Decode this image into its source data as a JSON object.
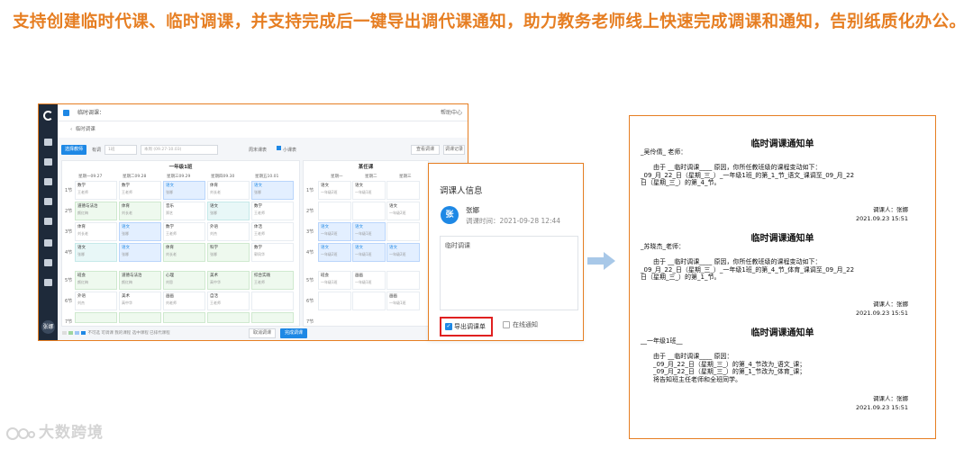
{
  "headline": "支持创建临时代课、临时调课，并支持完成后一键导出调代课通知，助力教务老师线上快速完成调课和通知，告别纸质化办公。",
  "app": {
    "title": "临时调课：",
    "help": "帮助中心",
    "breadcrumb": "临时调课",
    "user": "张娜",
    "toolbar": {
      "select_btn": "选择教师",
      "has": "有调",
      "sel1": "1班",
      "sel2": "本周 (09.27-10.03)",
      "check_label": "周末课表",
      "check2_label": "小课表",
      "btn_a": "查看调课",
      "btn_b": "调课记录"
    },
    "grid1": {
      "title": "一年级1班",
      "days": [
        "星期一09.27",
        "星期二09.28",
        "星期三09.29",
        "星期四09.30",
        "星期五10.01"
      ],
      "periods": [
        "1节",
        "2节",
        "3节",
        "4节",
        "5节",
        "6节",
        "7节"
      ]
    },
    "grid2": {
      "title": "某任课",
      "days": [
        "星期一",
        "星期二",
        "星期三"
      ]
    },
    "cells": [
      {
        "t": "数学",
        "s": "王老师"
      },
      {
        "t": "数学",
        "s": "王老师"
      },
      {
        "t": "语文",
        "s": "张娜"
      },
      {
        "t": "体育",
        "s": "刘长老"
      },
      {
        "t": "语文",
        "s": "张娜"
      },
      {
        "t": "道德与法治",
        "s": "颜红梅"
      },
      {
        "t": "体育",
        "s": "刘长老"
      },
      {
        "t": "音乐",
        "s": "郑艺"
      },
      {
        "t": "语文",
        "s": "张娜"
      },
      {
        "t": "数学",
        "s": "王老师"
      },
      {
        "t": "体育",
        "s": "刘长老"
      },
      {
        "t": "语文",
        "s": "张娜"
      },
      {
        "t": "数学",
        "s": "王老师"
      },
      {
        "t": "外语",
        "s": "刘杰"
      },
      {
        "t": "体活",
        "s": "王老师"
      },
      {
        "t": "语文",
        "s": "张娜"
      },
      {
        "t": "语文",
        "s": "张娜"
      },
      {
        "t": "体育",
        "s": "刘长老"
      },
      {
        "t": "科学",
        "s": "张娜"
      },
      {
        "t": "数学",
        "s": "郭凤华"
      },
      {
        "t": "班会",
        "s": "颜红梅"
      },
      {
        "t": "道德与法治",
        "s": "颜红梅"
      },
      {
        "t": "心理",
        "s": "刘思"
      },
      {
        "t": "美术",
        "s": "高中华"
      },
      {
        "t": "综合实践",
        "s": "王老师"
      },
      {
        "t": "外语",
        "s": "刘杰"
      },
      {
        "t": "美术",
        "s": "高中华"
      },
      {
        "t": "画画",
        "s": "刘老师"
      },
      {
        "t": "自活",
        "s": "王老师"
      },
      {
        "t": "",
        "s": ""
      }
    ],
    "cells2": [
      {
        "t": "语文",
        "s": "一年级2班"
      },
      {
        "t": "语文",
        "s": "一年级1班"
      },
      {
        "t": "",
        "s": ""
      },
      {
        "t": "",
        "s": ""
      },
      {
        "t": "",
        "s": ""
      },
      {
        "t": "语文",
        "s": "一年级2班"
      },
      {
        "t": "语文",
        "s": "一年级2班"
      },
      {
        "t": "语文",
        "s": "一年级1班"
      },
      {
        "t": "",
        "s": ""
      },
      {
        "t": "语文",
        "s": "一年级2班"
      },
      {
        "t": "语文",
        "s": "一年级1班"
      },
      {
        "t": "语文",
        "s": "一年级2班"
      },
      {
        "t": "班会",
        "s": "一年级1班"
      },
      {
        "t": "画画",
        "s": "一年级1班"
      },
      {
        "t": "",
        "s": ""
      },
      {
        "t": "",
        "s": ""
      },
      {
        "t": "",
        "s": ""
      },
      {
        "t": "画画",
        "s": "一年级1班"
      }
    ],
    "legend": "不可选 可调课 我的课程 选中课程 已排代课程",
    "footer_btn_cancel": "取消调课",
    "footer_btn_ok": "完成调课"
  },
  "dialog": {
    "title": "调课人信息",
    "avatar": "张",
    "name": "张娜",
    "time": "调课时间：2021-09-28 12:44",
    "reason": "临时调课",
    "export_label": "导出调课单",
    "online_label": "在线通知"
  },
  "doc": {
    "notices": [
      {
        "title": "临时调课通知单",
        "lines": [
          "_吴伶倩_ 老师：",
          "",
          "由于 __临时调课____ 原因，你所任教班级的课程变动如下：",
          "_09_月_22_日（星期_三_）_一年级1班_的第_1_节_语文_课调至_09_月_22",
          "日（星期_三_）的第_4_节。"
        ],
        "sign": "调课人：张娜",
        "date": "2021.09.23 15:51"
      },
      {
        "title": "临时调课通知单",
        "lines": [
          "_苏晓杰_老师：",
          "",
          "由于 __临时调课____ 原因，你所任教班级的课程变动如下：",
          "_09_月_22_日（星期_三_）_一年级1班_的第_4_节_体育_课调至_09_月_22",
          "日（星期_三_）的第_1_节。"
        ],
        "sign": "调课人：张娜",
        "date": "2021.09.23 15:51"
      },
      {
        "title": "临时调课通知单",
        "lines": [
          "__一年级1班__",
          "",
          "由于 __临时调课____ 原因：",
          "_09_月_22_日（星期_三_）的第_4_节改为_语文_课；",
          "_09_月_22_日（星期_三_）的第_1_节改为_体育_课；",
          "将告知班主任老师和全班同学。"
        ],
        "sign": "调课人：张娜",
        "date": "2021.09.23 15:51"
      }
    ]
  },
  "watermark": "大数跨境",
  "colors": {
    "accent": "#e67e22",
    "primary": "#1e88e5",
    "highlight": "#e02020"
  }
}
